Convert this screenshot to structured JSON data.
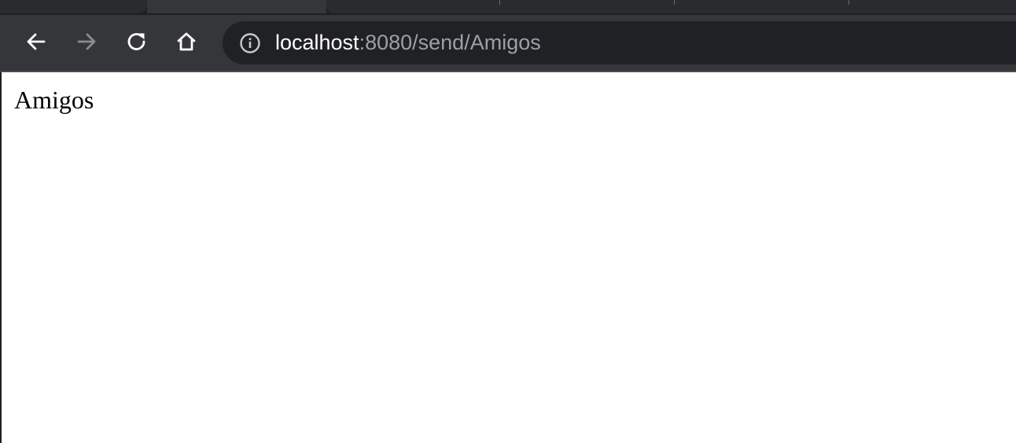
{
  "toolbar": {
    "back_icon": "arrow-left-icon",
    "forward_icon": "arrow-right-icon",
    "forward_disabled": true,
    "reload_icon": "reload-icon",
    "home_icon": "home-icon"
  },
  "address_bar": {
    "info_icon": "info-icon",
    "host": "localhost",
    "rest": ":8080/send/Amigos"
  },
  "page": {
    "text": "Amigos"
  },
  "colors": {
    "toolbar_bg": "#35363a",
    "tabstrip_bg": "#1e1f22",
    "omnibox_bg": "#202124",
    "url_host": "#ffffff",
    "url_rest": "#9aa0a6",
    "page_bg": "#ffffff"
  }
}
